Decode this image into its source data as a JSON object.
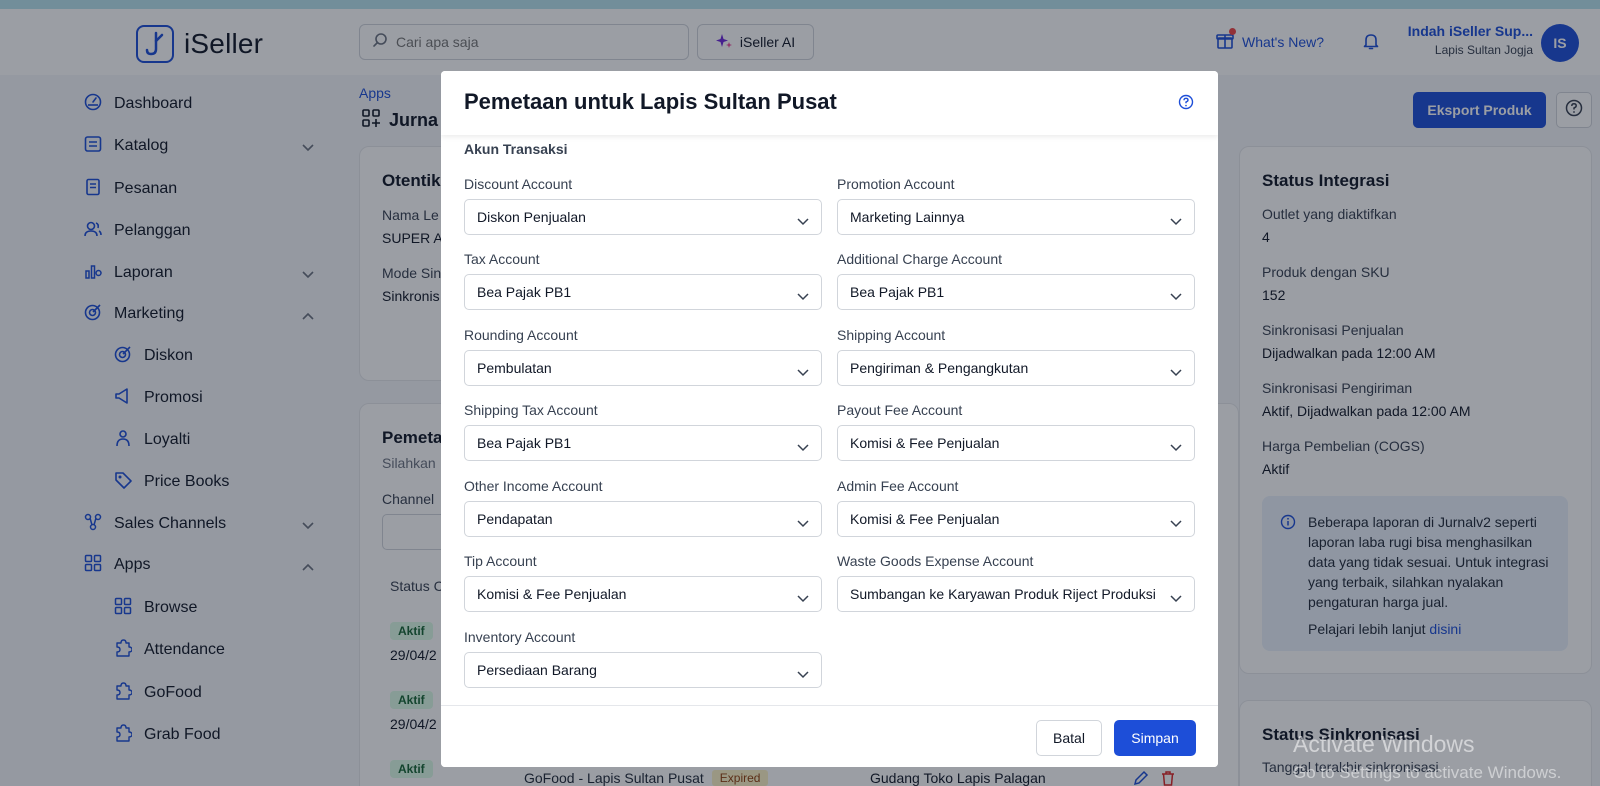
{
  "header": {
    "logo_text": "iSeller",
    "search_placeholder": "Cari apa saja",
    "ai_label": "iSeller AI",
    "whats_new": "What's New?",
    "user_name": "Indah iSeller Sup...",
    "user_store": "Lapis Sultan Jogja",
    "avatar_initials": "IS"
  },
  "sidebar": {
    "items": [
      {
        "label": "Dashboard",
        "icon": "dashboard-icon"
      },
      {
        "label": "Katalog",
        "icon": "catalog-icon"
      },
      {
        "label": "Pesanan",
        "icon": "orders-icon"
      },
      {
        "label": "Pelanggan",
        "icon": "customers-icon"
      },
      {
        "label": "Laporan",
        "icon": "reports-icon"
      },
      {
        "label": "Marketing",
        "icon": "marketing-icon"
      },
      {
        "label": "Diskon",
        "icon": "discount-icon"
      },
      {
        "label": "Promosi",
        "icon": "promotion-icon"
      },
      {
        "label": "Loyalti",
        "icon": "loyalty-icon"
      },
      {
        "label": "Price Books",
        "icon": "price-books-icon"
      },
      {
        "label": "Sales Channels",
        "icon": "sales-channels-icon"
      },
      {
        "label": "Apps",
        "icon": "apps-icon"
      },
      {
        "label": "Browse",
        "icon": "browse-icon"
      },
      {
        "label": "Attendance",
        "icon": "puzzle-icon"
      },
      {
        "label": "GoFood",
        "icon": "puzzle-icon"
      },
      {
        "label": "Grab Food",
        "icon": "puzzle-icon"
      }
    ]
  },
  "main": {
    "breadcrumb": "Apps",
    "title": "Jurna",
    "export_label": "Eksport Produk",
    "auth_card": {
      "title": "Otentik",
      "field1_label": "Nama Le",
      "field1_value": "SUPER A",
      "field2_label": "Mode Sin",
      "field2_value": "Sinkronis"
    },
    "mapping_card": {
      "title": "Pemeta",
      "subtitle": "Silahkan",
      "channel_label": "Channel",
      "col_status": "Status C",
      "rows": [
        {
          "status": "Aktif",
          "date": "29/04/2"
        },
        {
          "status": "Aktif",
          "date": "29/04/2"
        },
        {
          "status": "Aktif",
          "channel": "GoFood - Lapis Sultan Pusat",
          "badge": "Expired",
          "warehouse": "Gudang Toko Lapis Palagan"
        }
      ]
    },
    "status_integrasi": {
      "title": "Status Integrasi",
      "rows": [
        {
          "key": "Outlet yang diaktifkan",
          "value": "4"
        },
        {
          "key": "Produk dengan SKU",
          "value": "152"
        },
        {
          "key": "Sinkronisasi Penjualan",
          "value": "Dijadwalkan pada 12:00 AM"
        },
        {
          "key": "Sinkronisasi Pengiriman",
          "value": "Aktif, Dijadwalkan pada 12:00 AM"
        },
        {
          "key": "Harga Pembelian (COGS)",
          "value": "Aktif"
        }
      ],
      "info_text": "Beberapa laporan di Jurnalv2 seperti laporan laba rugi bisa menghasilkan data yang tidak sesuai. Untuk integrasi yang terbaik, silahkan nyalakan pengaturan harga jual.",
      "info_more": "Pelajari lebih lanjut",
      "info_link": "disini"
    },
    "status_sinkronisasi": {
      "title": "Status Sinkronisasi",
      "last_sync_label": "Tanggal terakhir sinkronisasi"
    }
  },
  "modal": {
    "title": "Pemetaan untuk Lapis Sultan Pusat",
    "section": "Akun Transaksi",
    "fields": [
      {
        "label": "Discount Account",
        "value": "Diskon Penjualan"
      },
      {
        "label": "Promotion Account",
        "value": "Marketing Lainnya"
      },
      {
        "label": "Tax Account",
        "value": "Bea Pajak PB1"
      },
      {
        "label": "Additional Charge Account",
        "value": "Bea Pajak PB1"
      },
      {
        "label": "Rounding Account",
        "value": "Pembulatan"
      },
      {
        "label": "Shipping Account",
        "value": "Pengiriman & Pengangkutan"
      },
      {
        "label": "Shipping Tax Account",
        "value": "Bea Pajak PB1"
      },
      {
        "label": "Payout Fee Account",
        "value": "Komisi & Fee Penjualan"
      },
      {
        "label": "Other Income Account",
        "value": "Pendapatan"
      },
      {
        "label": "Admin Fee Account",
        "value": "Komisi & Fee Penjualan"
      },
      {
        "label": "Tip Account",
        "value": "Komisi & Fee Penjualan"
      },
      {
        "label": "Waste Goods Expense Account",
        "value": "Sumbangan ke Karyawan Produk Riject Produksi"
      },
      {
        "label": "Inventory Account",
        "value": "Persediaan Barang"
      }
    ],
    "cancel_label": "Batal",
    "save_label": "Simpan"
  },
  "os_watermark": {
    "line1": "Activate Windows",
    "line2": "Go to Settings to activate Windows."
  },
  "colors": {
    "accent": "#1d4ed8",
    "overlay": "#111827"
  }
}
